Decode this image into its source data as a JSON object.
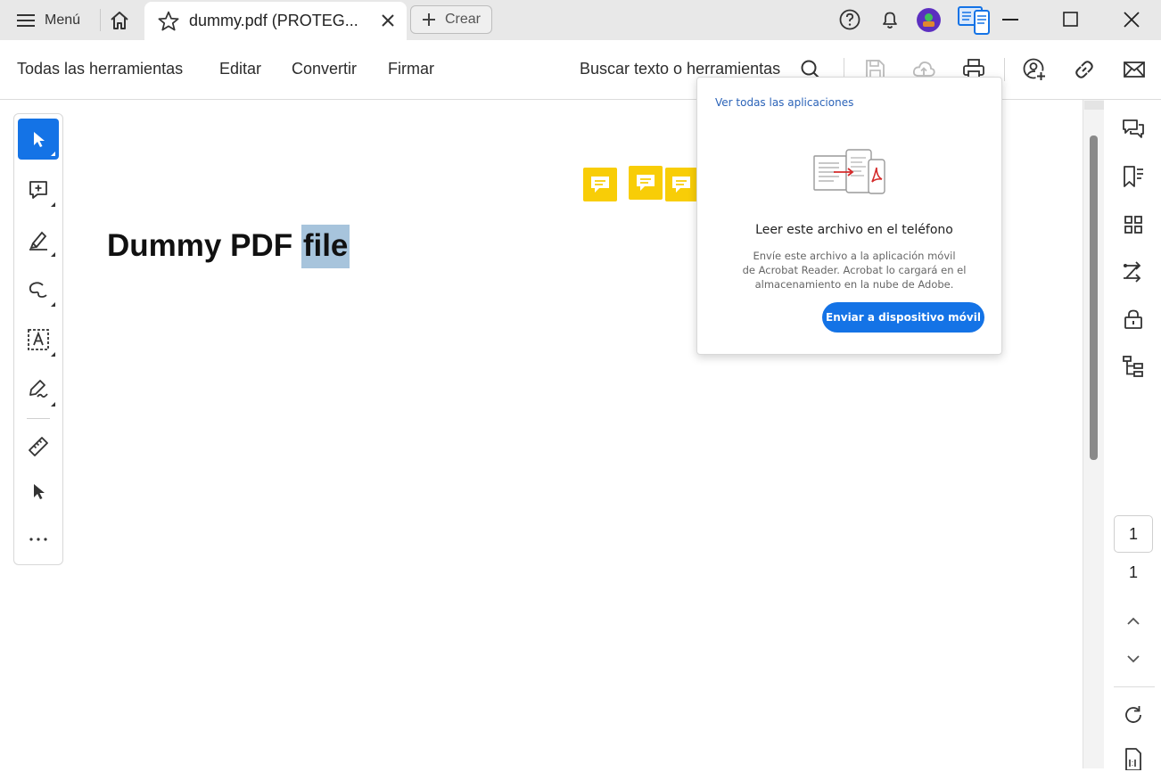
{
  "titlebar": {
    "menu_label": "Menú",
    "tab_title": "dummy.pdf (PROTEG...",
    "create_label": "Crear"
  },
  "toolbar": {
    "items": [
      "Todas las herramientas",
      "Editar",
      "Convertir",
      "Firmar"
    ],
    "search_label": "Buscar texto o herramientas"
  },
  "document": {
    "heading_text": "Dummy PDF ",
    "heading_selected": "file"
  },
  "pagination": {
    "current_page": "1",
    "total_pages": "1"
  },
  "popup": {
    "link": "Ver todas las aplicaciones",
    "title": "Leer este archivo en el teléfono",
    "desc_lines": [
      "Envíe este archivo a la aplicación móvil",
      "de Acrobat Reader. Acrobat lo cargará en el",
      "almacenamiento en la nube de Adobe."
    ],
    "button": "Enviar a dispositivo móvil"
  },
  "colors": {
    "accent": "#1473e6",
    "sticky_note": "#f8cd07",
    "selection": "#a7c4dc"
  },
  "icons": {
    "left_rail": [
      "select-arrow-icon",
      "add-comment-icon",
      "highlight-icon",
      "draw-icon",
      "text-box-icon",
      "sign-icon",
      "measure-icon",
      "cursor-icon",
      "more-icon"
    ],
    "right_rail": [
      "comments-icon",
      "bookmarks-icon",
      "thumbnails-icon",
      "organize-icon",
      "protect-icon",
      "structure-icon",
      "rotate-icon",
      "page-fit-icon"
    ]
  }
}
